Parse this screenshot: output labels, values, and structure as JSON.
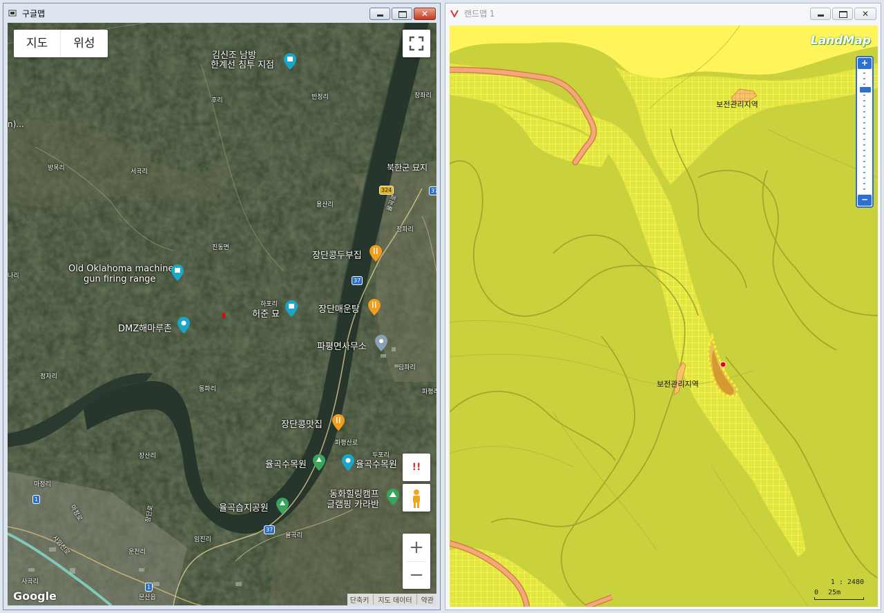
{
  "left_window": {
    "title": "구글맵",
    "controls": {
      "minimize": "",
      "maximize": "",
      "close": "✕"
    },
    "map_type": {
      "map": "지도",
      "satellite": "위성"
    },
    "labels": {
      "kimsinjo": "김신조 남방",
      "kimsinjo2": "한계선 침투 지점",
      "banjeongri": "반정리",
      "jeongjari": "장좌리",
      "huri": "후리",
      "parital": "n)...",
      "bukhangun": "북한군 묘지",
      "bangmokri": "방목리",
      "seogokri": "서곡리",
      "yongsanri": "용산리",
      "jangpari": "장파리",
      "jindongmyeon": "진동면",
      "jangdan_bujip": "장단콩두부집",
      "oklahoma1": "Old Oklahoma machine",
      "oklahoma2": "gun firing range",
      "nari": "나리",
      "hapori": "하포리",
      "heojun": "허준 묘",
      "jangdan_maeun": "장단매운탕",
      "dmz": "DMZ해마루촌",
      "papyeong_office": "파평면사무소",
      "geumpari": "금파리",
      "jeongjari2": "정자리",
      "dongpari": "동파리",
      "papyeong_ri": "파평리",
      "jangdan_mat": "장단콩맛집",
      "papyeong_ro": "파평산로",
      "dupori": "두포리",
      "jangsanri": "장산리",
      "yulgok1": "율곡수목원",
      "yulgok2": "율곡수목원",
      "majeongri": "마정리",
      "donghwa1": "동화힐링캠프",
      "donghwa2": "글램핑 카라반",
      "yulgok_park": "율곡습지공원",
      "imjinri": "임진리",
      "yulgokri": "율곡리",
      "uncheonri": "운천리",
      "sagokri": "사곡리",
      "munsaneup": "문산읍",
      "majeong_ro": "마정로",
      "saimjin_ro": "사임진로",
      "jangdan_ro": "장단로",
      "yulgok_ro2": "율곡로"
    },
    "route_shields": {
      "r324": "324",
      "r37a": "37",
      "r37b": "37",
      "r37c": "37",
      "r1a": "1",
      "r1b": "1"
    },
    "alert_label": "!!",
    "zoom_in": "+",
    "zoom_out": "−",
    "credits": [
      "단축키",
      "지도 데이터",
      "약관"
    ],
    "logo": "Google"
  },
  "right_window": {
    "title": "랜드맵 1",
    "controls": {
      "minimize": "",
      "maximize": "",
      "close": "✕"
    },
    "logo": "LandMap",
    "zone_labels": {
      "top": "보전관리지역",
      "mid": "보전관리지역"
    },
    "zoom_in": "+",
    "zoom_out": "−",
    "scale": {
      "ratio": "1 : 2480",
      "zero": "0",
      "distance": "25m"
    }
  },
  "colors": {
    "satellite_dark": "#26331f",
    "land_green": "#c9d23c",
    "land_yellow": "#fff55a",
    "grid_yellow": "#ffff66",
    "road_orange": "#f0a070",
    "parcel_brown": "#d8a030",
    "accent_blue": "#2f6fcf"
  },
  "icons": [
    "pin-icon",
    "fork-knife-icon",
    "camera-icon",
    "castle-icon",
    "tree-icon",
    "tent-icon",
    "fullscreen-icon",
    "pegman-icon",
    "app-icon",
    "landmap-logo-icon"
  ]
}
